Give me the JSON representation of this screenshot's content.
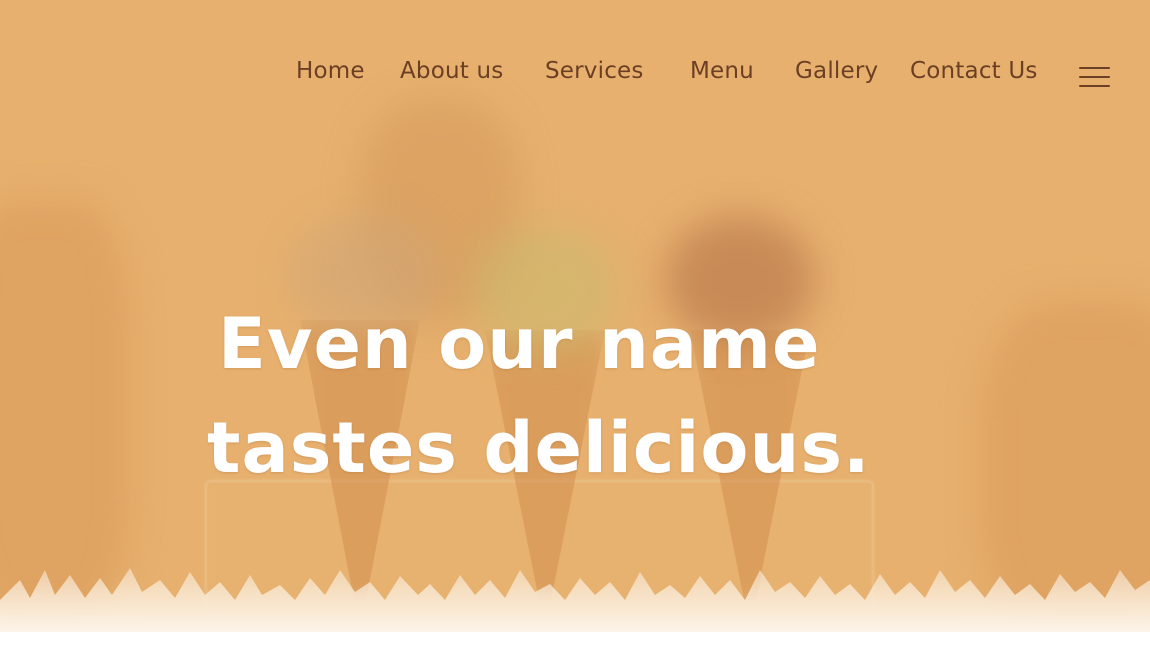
{
  "nav": {
    "items": [
      {
        "label": "Home"
      },
      {
        "label": "About us"
      },
      {
        "label": "Services"
      },
      {
        "label": "Menu"
      },
      {
        "label": "Gallery"
      },
      {
        "label": "Contact Us"
      }
    ],
    "menu_icon": "hamburger-menu-icon"
  },
  "hero": {
    "headline_line1": "Even our name",
    "headline_line2": "tastes delicious."
  },
  "colors": {
    "hero_overlay": "#e7b06e",
    "nav_text": "#6b3f24",
    "headline_text": "#ffffff"
  }
}
